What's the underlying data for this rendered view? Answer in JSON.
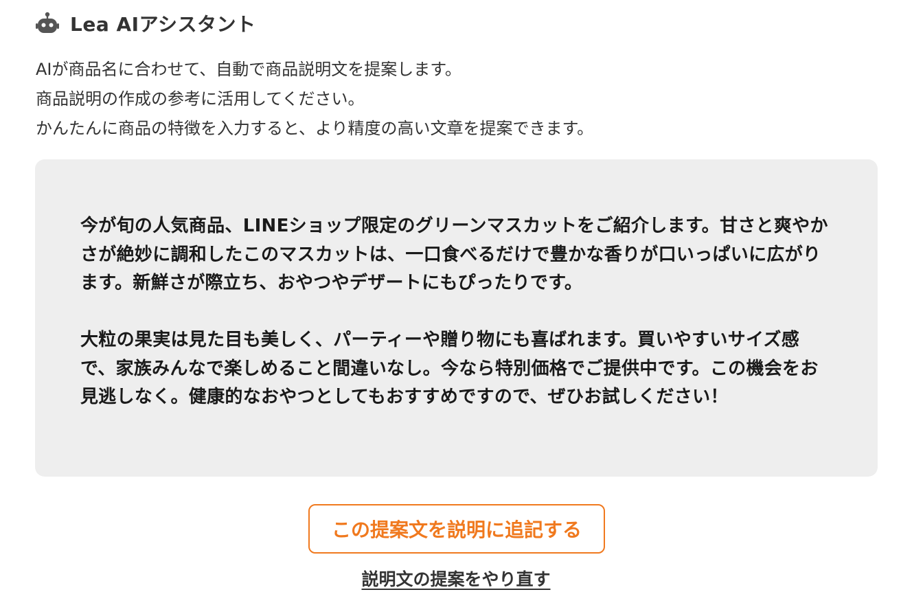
{
  "header": {
    "icon": "robot-icon",
    "title": "Lea AIアシスタント"
  },
  "intro": {
    "lines": [
      "AIが商品名に合わせて、自動で商品説明文を提案します。",
      "商品説明の作成の参考に活用してください。",
      "かんたんに商品の特徴を入力すると、より精度の高い文章を提案できます。"
    ]
  },
  "suggestion": {
    "paragraphs": [
      "今が旬の人気商品、LINEショップ限定のグリーンマスカットをご紹介します。甘さと爽やかさが絶妙に調和したこのマスカットは、一口食べるだけで豊かな香りが口いっぱいに広がります。新鮮さが際立ち、おやつやデザートにもぴったりです。",
      "大粒の果実は見た目も美しく、パーティーや贈り物にも喜ばれます。買いやすいサイズ感で、家族みんなで楽しめること間違いなし。今なら特別価格でご提供中です。この機会をお見逃しなく。健康的なおやつとしてもおすすめですので、ぜひお試しください！"
    ]
  },
  "actions": {
    "append_label": "この提案文を説明に追記する",
    "redo_label": "説明文の提案をやり直す"
  },
  "colors": {
    "accent": "#f0791e",
    "box_bg": "#eeeeee",
    "text": "#333333"
  }
}
